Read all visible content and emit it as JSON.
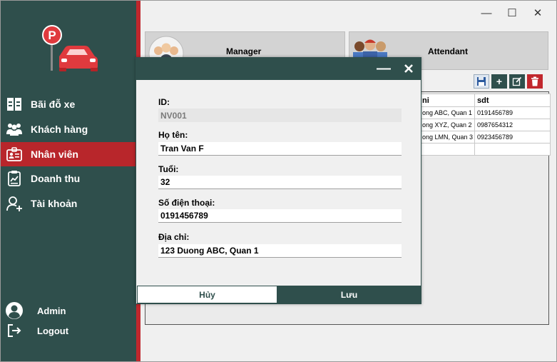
{
  "sidebar": {
    "items": [
      {
        "label": "Bãi đỗ xe",
        "icon": "parking-lot-icon"
      },
      {
        "label": "Khách hàng",
        "icon": "customers-icon"
      },
      {
        "label": "Nhân viên",
        "icon": "employee-badge-icon",
        "active": true
      },
      {
        "label": "Doanh thu",
        "icon": "revenue-report-icon"
      },
      {
        "label": "Tài khoản",
        "icon": "add-user-icon"
      }
    ],
    "user_name": "Admin",
    "logout_label": "Logout"
  },
  "window": {
    "minimize": "—",
    "maximize": "☐",
    "close": "✕"
  },
  "cards": {
    "manager": "Manager",
    "attendant": "Attendant"
  },
  "toolbar": {
    "add_symbol": "+"
  },
  "table": {
    "columns": [
      "ni",
      "sdt"
    ],
    "rows": [
      [
        "ong ABC, Quan 1",
        "0191456789"
      ],
      [
        "ong XYZ, Quan 2",
        "0987654312"
      ],
      [
        "ong LMN, Quan 3",
        "0923456789"
      ],
      [
        "",
        ""
      ]
    ]
  },
  "dialog": {
    "minimize": "—",
    "fields": {
      "id_label": "ID:",
      "id_value": "NV001",
      "name_label": "Họ tên:",
      "name_value": "Tran Van F",
      "age_label": "Tuổi:",
      "age_value": "32",
      "phone_label": "Số điện thoại:",
      "phone_value": "0191456789",
      "address_label": "Địa chỉ:",
      "address_value": "123 Duong ABC, Quan 1"
    },
    "cancel_label": "Hủy",
    "save_label": "Lưu"
  },
  "colors": {
    "sidebar": "#2f4f4c",
    "accent_red": "#c0272d",
    "dialog_header": "#2f4f4c"
  }
}
